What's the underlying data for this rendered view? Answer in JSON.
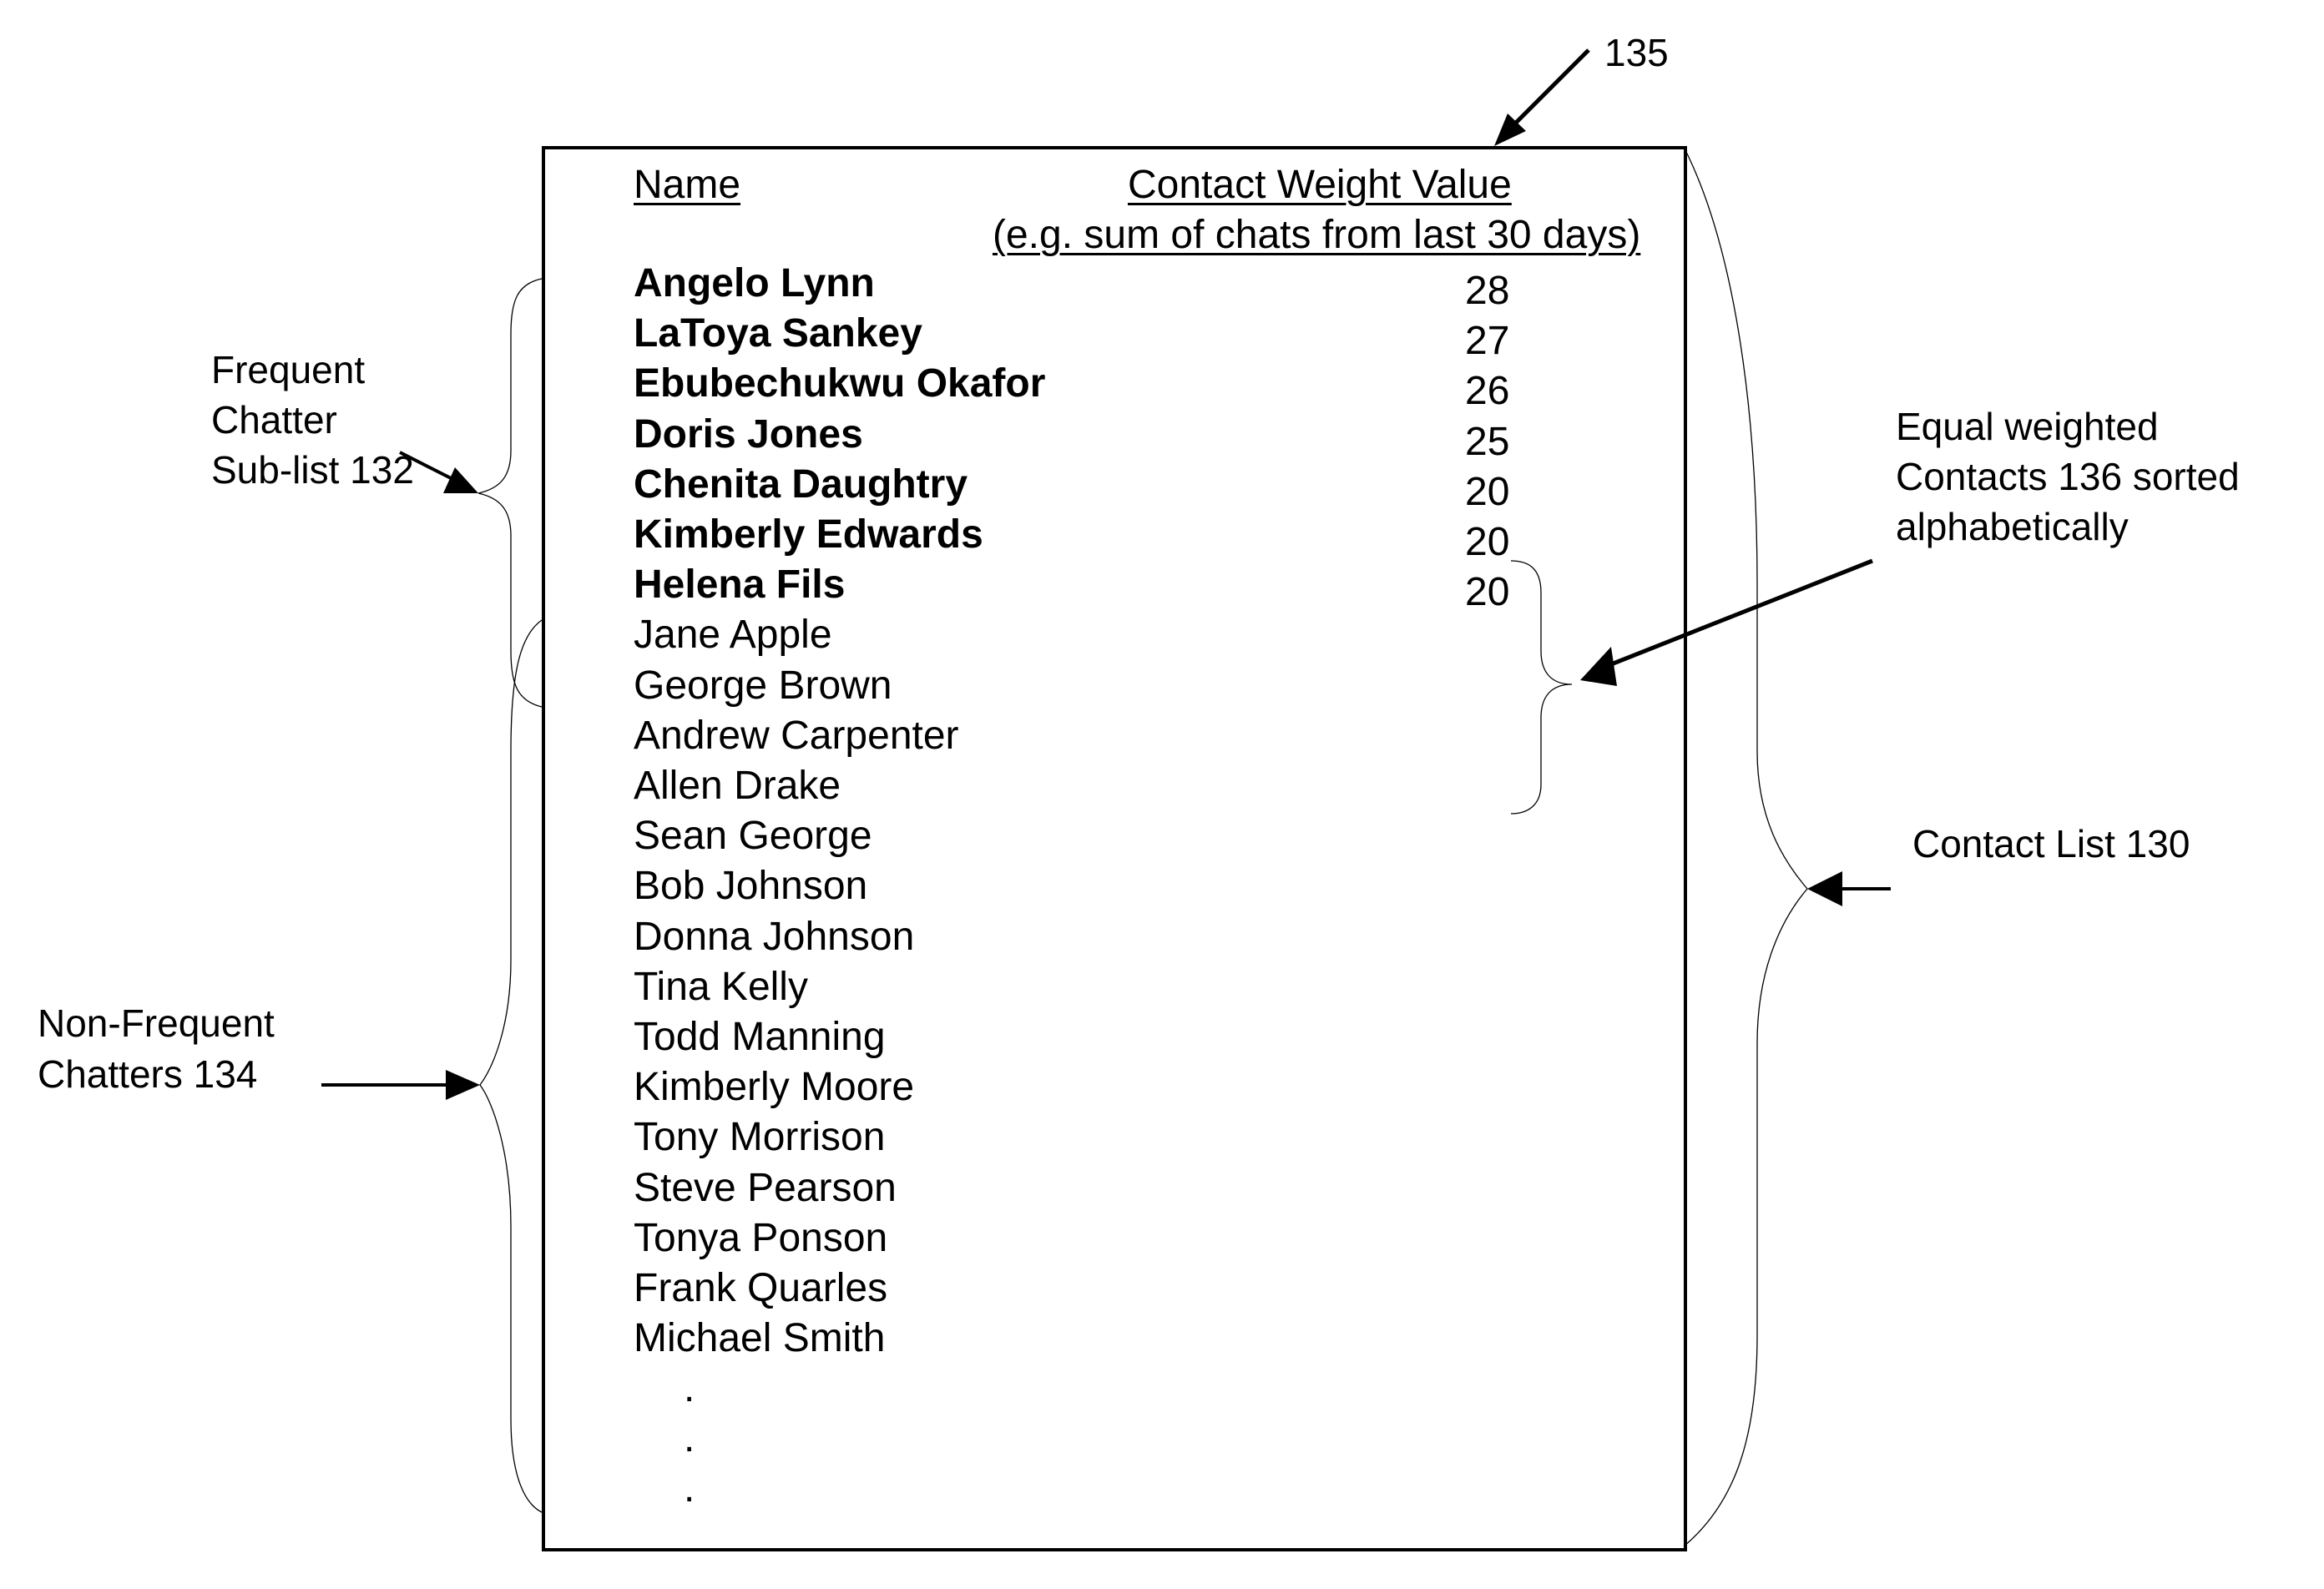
{
  "reference": {
    "label": "135"
  },
  "table": {
    "header_name": "Name",
    "header_weight": "Contact Weight Value",
    "header_weight_sub": "(e.g. sum of chats from last 30 days)",
    "frequent": [
      {
        "name": "Angelo Lynn",
        "weight": "28"
      },
      {
        "name": "LaToya Sankey",
        "weight": "27"
      },
      {
        "name": "Ebubechukwu Okafor",
        "weight": "26"
      },
      {
        "name": "Doris Jones",
        "weight": "25"
      },
      {
        "name": "Chenita Daughtry",
        "weight": "20"
      },
      {
        "name": "Kimberly Edwards",
        "weight": "20"
      },
      {
        "name": "Helena Fils",
        "weight": "20"
      }
    ],
    "non_frequent": [
      "Jane Apple",
      "George Brown",
      "Andrew Carpenter",
      "Allen Drake",
      "Sean George",
      "Bob Johnson",
      "Donna Johnson",
      "Tina Kelly",
      "Todd Manning",
      "Kimberly Moore",
      "Tony Morrison",
      "Steve Pearson",
      "Tonya Ponson",
      "Frank Quarles",
      "Michael Smith"
    ],
    "ellipsis": [
      ".",
      ".",
      "."
    ]
  },
  "annotations": {
    "frequent_sublist": [
      "Frequent",
      "Chatter",
      "Sub-list 132"
    ],
    "non_frequent": [
      "Non-Frequent",
      "Chatters 134"
    ],
    "equal_weighted": [
      "Equal weighted",
      "Contacts 136 sorted",
      "alphabetically"
    ],
    "contact_list": "Contact List 130"
  }
}
